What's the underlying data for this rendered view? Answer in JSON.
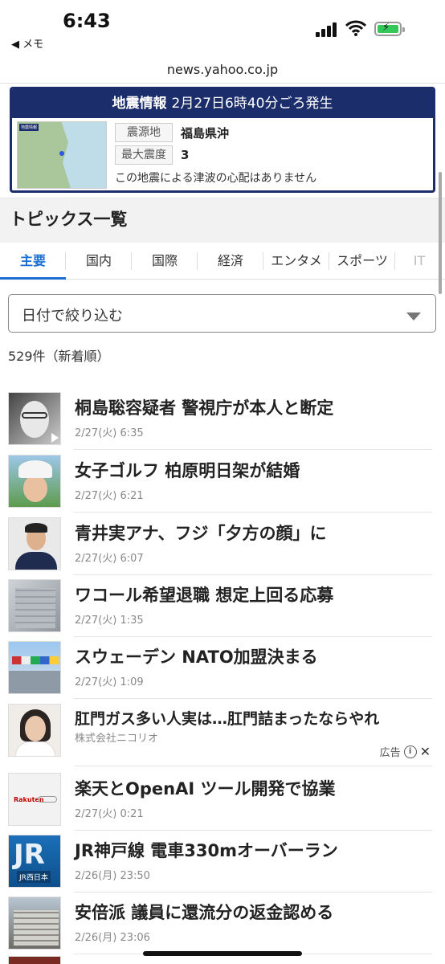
{
  "status": {
    "time": "6:43",
    "back_label": "◀ メモ"
  },
  "browser": {
    "url": "news.yahoo.co.jp"
  },
  "quake": {
    "title": "地震情報",
    "occurred": "2月27日6時40分ごろ発生",
    "map_tag": "地震情報",
    "epicenter_label": "震源地",
    "epicenter_value": "福島県沖",
    "max_intensity_label": "最大震度",
    "max_intensity_value": "3",
    "note": "この地震による津波の心配はありません"
  },
  "topics": {
    "title": "トピックス一覧",
    "tabs": [
      {
        "label": "主要"
      },
      {
        "label": "国内"
      },
      {
        "label": "国際"
      },
      {
        "label": "経済"
      },
      {
        "label": "エンタメ"
      },
      {
        "label": "スポーツ"
      },
      {
        "label": "IT"
      }
    ],
    "active_tab": "主要",
    "date_filter_label": "日付で絞り込む",
    "count": "529件（新着順）"
  },
  "news": [
    {
      "headline": "桐島聡容疑者 警視庁が本人と断定",
      "meta": "2/27(火) 6:35",
      "video": true
    },
    {
      "headline": "女子ゴルフ 柏原明日架が結婚",
      "meta": "2/27(火) 6:21"
    },
    {
      "headline": "青井実アナ、フジ「夕方の顔」に",
      "meta": "2/27(火) 6:07"
    },
    {
      "headline": "ワコール希望退職 想定上回る応募",
      "meta": "2/27(火) 1:35"
    },
    {
      "headline": "スウェーデン NATO加盟決まる",
      "meta": "2/27(火) 1:09"
    },
    {
      "headline": "肛門ガス多い人実は…肛門詰まったならやれ",
      "meta": "株式会社ニコリオ",
      "ad_label": "広告"
    },
    {
      "headline": "楽天とOpenAI ツール開発で協業",
      "meta": "2/27(火) 0:21",
      "thumb_logo": "Rakuten"
    },
    {
      "headline": "JR神戸線 電車330mオーバーラン",
      "meta": "2/26(月) 23:50",
      "thumb_logo": "JR",
      "thumb_sub": "JR西日本"
    },
    {
      "headline": "安倍派 議員に還流分の返金認める",
      "meta": "2/26(月) 23:06"
    }
  ]
}
